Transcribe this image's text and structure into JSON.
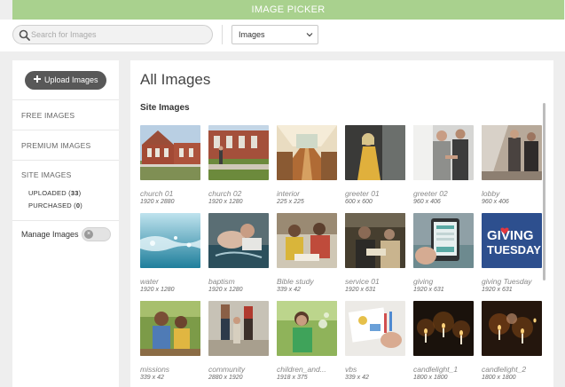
{
  "header": {
    "title": "IMAGE PICKER"
  },
  "search": {
    "placeholder": "Search for Images",
    "value": ""
  },
  "filter": {
    "selected": "Images"
  },
  "sidebar": {
    "upload_label": "Upload Images",
    "free_label": "FREE IMAGES",
    "premium_label": "PREMIUM IMAGES",
    "site_label": "SITE IMAGES",
    "uploaded_label": "UPLOADED (",
    "uploaded_count": "33",
    "purchased_label": "PURCHASED (",
    "purchased_count": "0",
    "close_paren": ")",
    "manage_label": "Manage Images",
    "manage_toggle_glyph": "×",
    "manage_enabled": false
  },
  "main": {
    "title": "All Images",
    "section_title": "Site Images",
    "images": [
      {
        "name": "church 01",
        "size": "1920 x 2880"
      },
      {
        "name": "church 02",
        "size": "1920 x 1280"
      },
      {
        "name": "interior",
        "size": "225 x 225"
      },
      {
        "name": "greeter 01",
        "size": "600 x 600"
      },
      {
        "name": "greeter 02",
        "size": "960 x 406"
      },
      {
        "name": "lobby",
        "size": "960 x 406"
      },
      {
        "name": "water",
        "size": "1920 x 1280"
      },
      {
        "name": "baptism",
        "size": "1920 x 1280"
      },
      {
        "name": "Bible study",
        "size": "339 x 42"
      },
      {
        "name": "service 01",
        "size": "1920 x 631"
      },
      {
        "name": "giving",
        "size": "1920 x 631"
      },
      {
        "name": "giving Tuesday",
        "size": "1920 x 631",
        "overlay_line1": "GIVING",
        "overlay_line2": "TUESDAY"
      },
      {
        "name": "missions",
        "size": "339 x 42"
      },
      {
        "name": "community",
        "size": "2880 x 1920"
      },
      {
        "name": "children_and...",
        "size": "1918 x 375"
      },
      {
        "name": "vbs",
        "size": "339 x 42"
      },
      {
        "name": "candlelight_1",
        "size": "1800 x 1800"
      },
      {
        "name": "candlelight_2",
        "size": "1800 x 1800"
      }
    ]
  },
  "colors": {
    "header_green": "#a9d18e",
    "upload_button": "#585858"
  }
}
